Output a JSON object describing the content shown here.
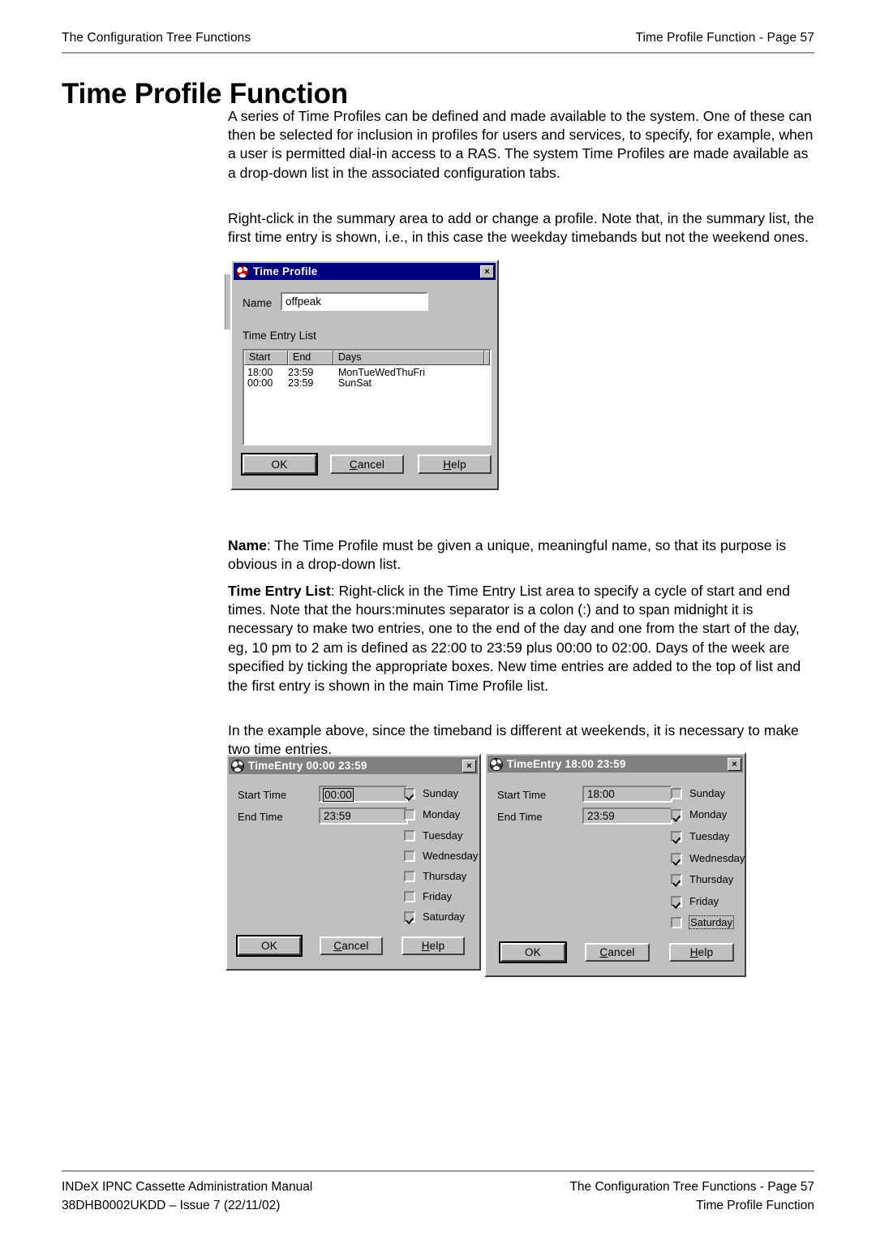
{
  "header": {
    "left": "The Configuration Tree Functions",
    "right": "Time Profile Function - Page 57"
  },
  "title": "Time Profile Function",
  "paragraphs": {
    "p1": "A series of Time Profiles can be defined and made available to the system. One of these can then be selected for inclusion in profiles for users and services, to specify, for example, when a user is permitted dial-in access to a RAS. The system Time Profiles are made available as a drop-down list in the associated configuration tabs.",
    "p2": "Right-click in the summary area to add or change a profile. Note that, in the summary list, the first time entry is shown, i.e., in this case the weekday timebands but not the weekend ones.",
    "p3_lead": "Name",
    "p3_rest": ": The Time Profile must be given a unique, meaningful name, so that its purpose is obvious in a drop-down list.",
    "p4_lead": "Time Entry List",
    "p4_rest": ": Right-click in the Time Entry List area to specify a cycle of start and end times. Note that the hours:minutes separator is a colon (:) and to span midnight it is necessary to make two entries, one to the end of the day and one from the start of the day, eg, 10 pm to 2 am is defined as 22:00 to 23:59 plus 00:00 to 02:00. Days of the week are specified by ticking the appropriate boxes. New time entries are added to the top of list and the first entry is shown in the main Time Profile list.",
    "p5": "In the example above, since the timeband is different at weekends, it is necessary to make two time entries."
  },
  "time_profile_dialog": {
    "title": "Time Profile",
    "close_label": "×",
    "name_label": "Name",
    "name_value": "offpeak",
    "list_label": "Time Entry List",
    "columns": [
      "Start",
      "End",
      "Days"
    ],
    "rows": [
      {
        "start": "18:00",
        "end": "23:59",
        "days": "MonTueWedThuFri"
      },
      {
        "start": "00:00",
        "end": "23:59",
        "days": "SunSat"
      }
    ],
    "buttons": {
      "ok": "OK",
      "cancel_pre": "",
      "cancel_mn": "C",
      "cancel_post": "ancel",
      "help_mn": "H",
      "help_post": "elp"
    }
  },
  "timeentry_left": {
    "title": "TimeEntry 00:00 23:59",
    "close_label": "×",
    "start_label": "Start Time",
    "start_value": "00:00",
    "end_label": "End Time",
    "end_value": "23:59",
    "days": [
      {
        "label": "Sunday",
        "checked": true,
        "focus": false
      },
      {
        "label": "Monday",
        "checked": false,
        "focus": false
      },
      {
        "label": "Tuesday",
        "checked": false,
        "focus": false
      },
      {
        "label": "Wednesday",
        "checked": false,
        "focus": false
      },
      {
        "label": "Thursday",
        "checked": false,
        "focus": false
      },
      {
        "label": "Friday",
        "checked": false,
        "focus": false
      },
      {
        "label": "Saturday",
        "checked": true,
        "focus": false
      }
    ],
    "buttons": {
      "ok": "OK",
      "cancel_mn": "C",
      "cancel_post": "ancel",
      "help_mn": "H",
      "help_post": "elp"
    }
  },
  "timeentry_right": {
    "title": "TimeEntry 18:00 23:59",
    "close_label": "×",
    "start_label": "Start Time",
    "start_value": "18:00",
    "end_label": "End Time",
    "end_value": "23:59",
    "days": [
      {
        "label": "Sunday",
        "checked": false,
        "focus": false
      },
      {
        "label": "Monday",
        "checked": true,
        "focus": false
      },
      {
        "label": "Tuesday",
        "checked": true,
        "focus": false
      },
      {
        "label": "Wednesday",
        "checked": true,
        "focus": false
      },
      {
        "label": "Thursday",
        "checked": true,
        "focus": false
      },
      {
        "label": "Friday",
        "checked": true,
        "focus": false
      },
      {
        "label": "Saturday",
        "checked": false,
        "focus": true
      }
    ],
    "buttons": {
      "ok": "OK",
      "cancel_mn": "C",
      "cancel_post": "ancel",
      "help_mn": "H",
      "help_post": "elp"
    }
  },
  "footer": {
    "left_line1": "INDeX IPNC Cassette Administration Manual",
    "left_line2": "38DHB0002UKDD – Issue 7 (22/11/02)",
    "right_line1": "The Configuration Tree Functions - Page 57",
    "right_line2": "Time Profile Function"
  },
  "colors": {
    "titlebar_active": "#000080",
    "titlebar_inactive": "#808080",
    "dialog_face": "#c0c0c0",
    "rule": "#9a9a9a"
  }
}
